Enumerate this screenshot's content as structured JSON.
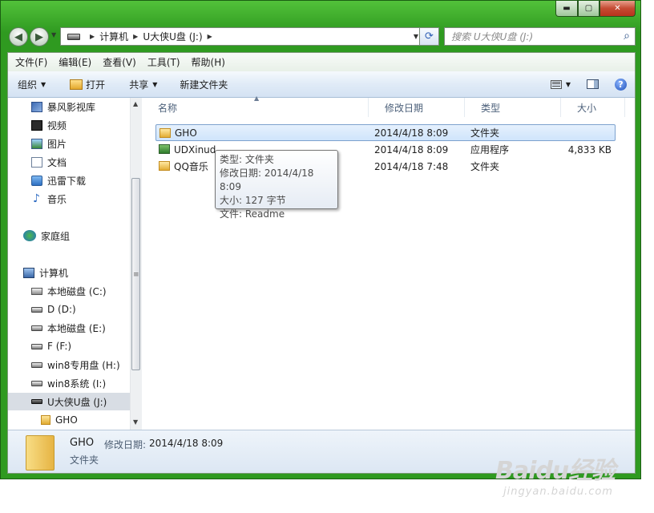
{
  "window": {
    "caption_buttons": {
      "minimize": "▬",
      "maximize": "▢",
      "close": "✕"
    }
  },
  "nav": {
    "back_icon": "◀",
    "forward_icon": "▶",
    "breadcrumbs": [
      "计算机",
      "U大侠U盘 (J:)"
    ],
    "refresh_icon": "⟳",
    "search_placeholder": "搜索 U大侠U盘 (J:)",
    "search_icon": "⌕"
  },
  "menu": [
    "文件(F)",
    "编辑(E)",
    "查看(V)",
    "工具(T)",
    "帮助(H)"
  ],
  "toolbar": {
    "organize": "组织",
    "open": "打开",
    "share": "共享",
    "new_folder": "新建文件夹",
    "help": "?"
  },
  "navpane": {
    "items": [
      {
        "label": "暴风影视库",
        "icon": "library-icon"
      },
      {
        "label": "视频",
        "icon": "video-icon"
      },
      {
        "label": "图片",
        "icon": "picture-icon"
      },
      {
        "label": "文档",
        "icon": "document-icon"
      },
      {
        "label": "迅雷下载",
        "icon": "download-icon"
      },
      {
        "label": "音乐",
        "icon": "music-icon"
      },
      {
        "label": "家庭组",
        "icon": "homegroup-icon"
      },
      {
        "label": "计算机",
        "icon": "computer-icon"
      },
      {
        "label": "本地磁盘 (C:)",
        "icon": "system-disk-icon"
      },
      {
        "label": "D (D:)",
        "icon": "disk-icon"
      },
      {
        "label": "本地磁盘 (E:)",
        "icon": "disk-icon"
      },
      {
        "label": "F (F:)",
        "icon": "disk-icon"
      },
      {
        "label": "win8专用盘 (H:)",
        "icon": "disk-icon"
      },
      {
        "label": "win8系统 (I:)",
        "icon": "disk-icon"
      },
      {
        "label": "U大侠U盘 (J:)",
        "icon": "usb-drive-icon",
        "selected": true
      },
      {
        "label": "GHO",
        "icon": "folder-icon"
      }
    ],
    "scroll_grip": "≡"
  },
  "columns": {
    "name": "名称",
    "modified": "修改日期",
    "type": "类型",
    "size": "大小"
  },
  "files": [
    {
      "name": "GHO",
      "modified": "2014/4/18 8:09",
      "type": "文件夹",
      "size": "",
      "icon": "folder-icon",
      "selected": true
    },
    {
      "name": "UDXinud",
      "modified": "2014/4/18 8:09",
      "type": "应用程序",
      "size": "4,833 KB",
      "icon": "application-icon"
    },
    {
      "name": "QQ音乐",
      "modified": "2014/4/18 7:48",
      "type": "文件夹",
      "size": "",
      "icon": "folder-icon"
    }
  ],
  "tooltip": {
    "type": "类型: 文件夹",
    "modified": "修改日期: 2014/4/18 8:09",
    "size": "大小: 127 字节",
    "files": "文件: Readme"
  },
  "details": {
    "name": "GHO",
    "modified_label": "修改日期:",
    "modified": "2014/4/18 8:09",
    "type": "文件夹"
  },
  "watermark": {
    "logo": "Baidu经验",
    "url": "jingyan.baidu.com"
  }
}
